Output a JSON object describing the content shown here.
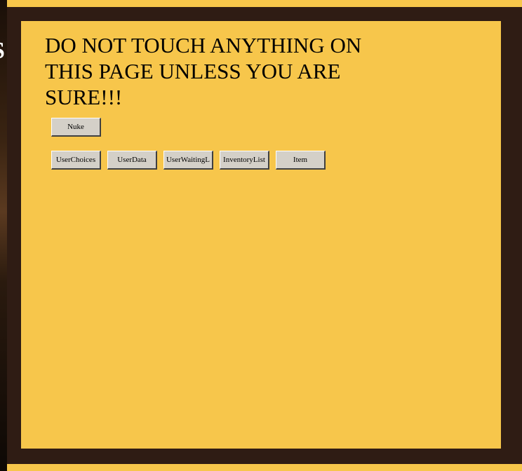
{
  "page": {
    "heading": "DO NOT TOUCH ANYTHING ON THIS PAGE UNLESS YOU ARE SURE!!!",
    "background_color": "#f7c64b",
    "frame_color": "#2f1c14"
  },
  "side_strip": {
    "visible_glyph": "S"
  },
  "buttons": {
    "nuke": "Nuke",
    "user_choices": "UserChoices",
    "user_data": "UserData",
    "user_waiting_list": "UserWaitingL",
    "inventory_list": "InventoryList",
    "item": "Item"
  }
}
